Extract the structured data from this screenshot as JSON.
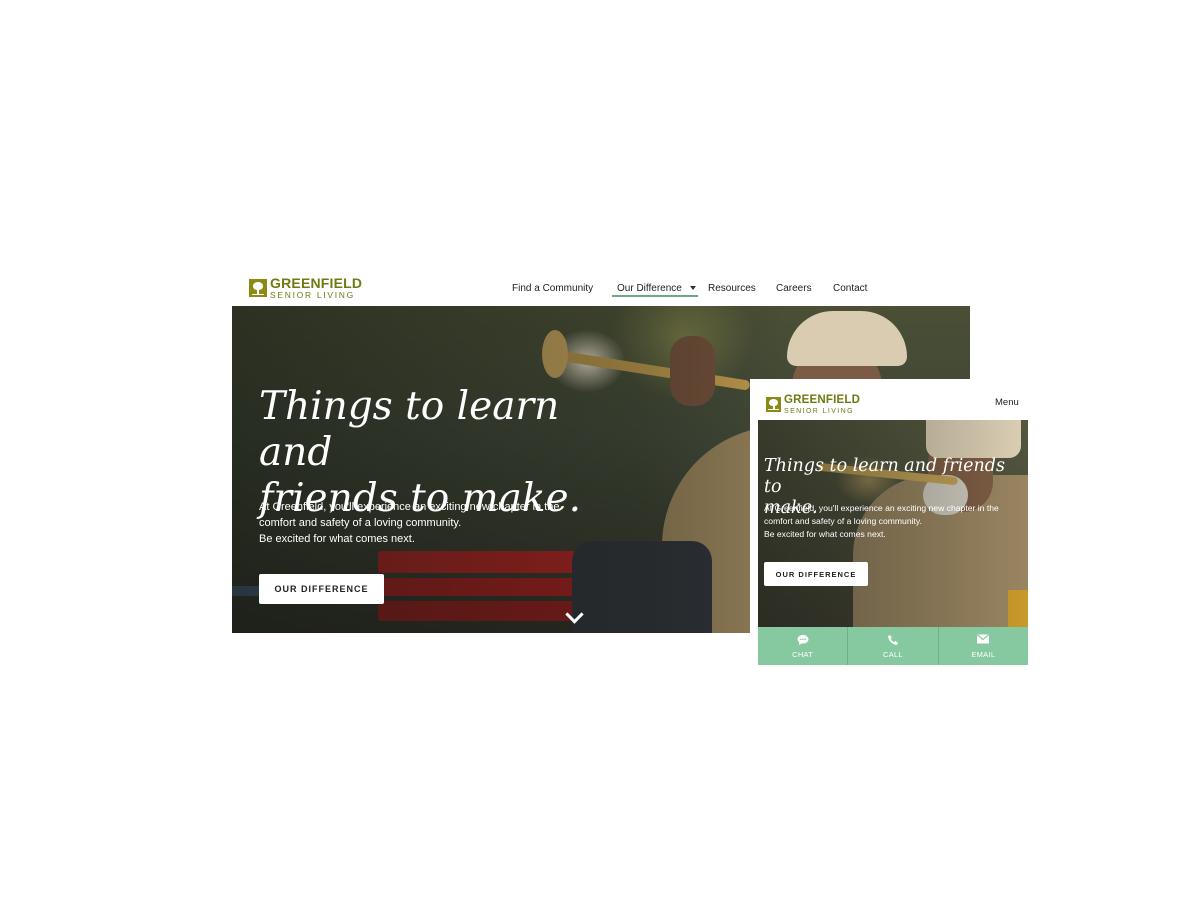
{
  "desktop": {
    "logo": {
      "line1": "GREENFIELD",
      "line2": "SENIOR LIVING"
    },
    "nav": {
      "items": [
        {
          "label": "Find a Community"
        },
        {
          "label": "Our Difference"
        },
        {
          "label": "Resources"
        },
        {
          "label": "Careers"
        },
        {
          "label": "Contact"
        }
      ],
      "active_item": "Our Difference"
    },
    "hero": {
      "headline_line1": "Things to learn and",
      "headline_line2": "friends to make.",
      "body_line1": "At Greenfield, you'll experience an exciting new chapter in the",
      "body_line2": "comfort and safety of a loving community.",
      "body_line3": "Be excited for what comes next.",
      "button_label": "OUR DIFFERENCE"
    }
  },
  "mobile": {
    "logo": {
      "line1": "GREENFIELD",
      "line2": "SENIOR LIVING"
    },
    "menu_label": "Menu",
    "hero": {
      "headline_line1": "Things to learn and friends to",
      "headline_line2": "make.",
      "body_line1": "At Greenfield, you'll experience an exciting new chapter in the",
      "body_line2": "comfort and safety of a loving community.",
      "body_line3": "Be excited for what comes next.",
      "button_label": "OUR DIFFERENCE"
    },
    "actions": [
      {
        "label": "CHAT",
        "icon": "chat-icon"
      },
      {
        "label": "CALL",
        "icon": "phone-icon"
      },
      {
        "label": "EMAIL",
        "icon": "email-icon"
      }
    ]
  },
  "colors": {
    "brand": "#6f7a12",
    "logo_mark": "#8a8a14",
    "accent_green": "#86c9a0",
    "nav_underline": "#6aa987"
  }
}
